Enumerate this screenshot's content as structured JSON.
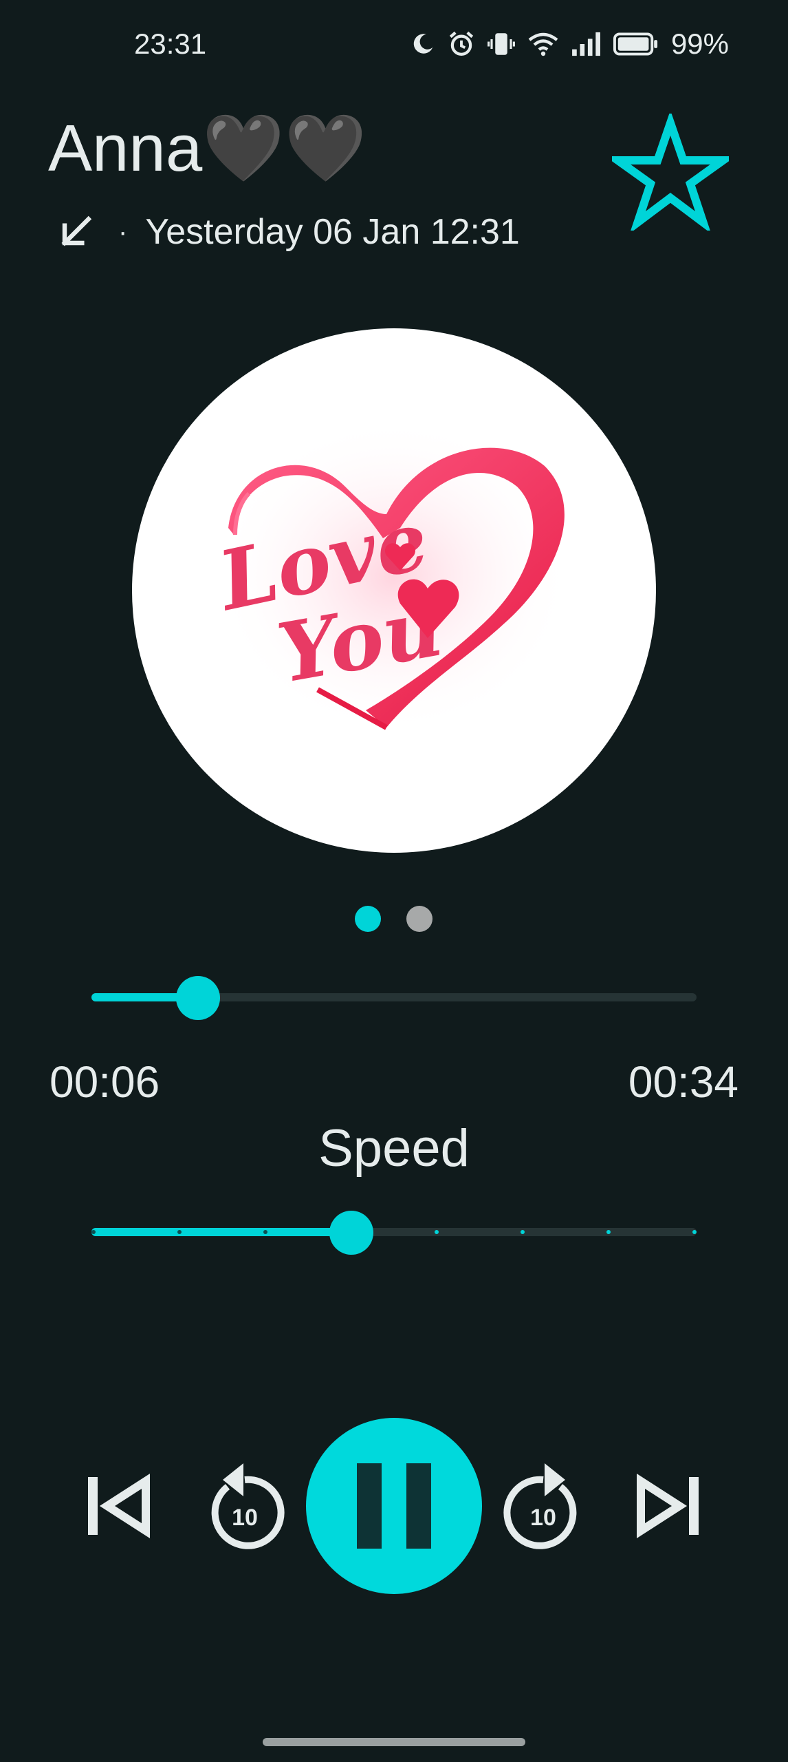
{
  "status_bar": {
    "time": "23:31",
    "battery": "99%",
    "icons": [
      "moon-icon",
      "alarm-icon",
      "vibrate-icon",
      "wifi-icon",
      "signal-icon",
      "battery-icon"
    ]
  },
  "header": {
    "contact_name": "Anna🖤🖤",
    "call_direction_icon": "incoming-call-arrow-icon",
    "separator": "·",
    "call_time": "Yesterday 06 Jan 12:31",
    "favorite_icon": "star-outline-icon"
  },
  "artwork": {
    "line1": "Love",
    "line2": "You"
  },
  "pager": {
    "pages": 2,
    "active": 1
  },
  "player": {
    "elapsed": "00:06",
    "total": "00:34",
    "progress": 0.176,
    "speed_label": "Speed",
    "speed_steps": 8,
    "speed_index": 3
  },
  "controls": [
    {
      "name": "previous-button",
      "icon": "skip-previous-icon"
    },
    {
      "name": "rewind-10-button",
      "icon": "replay-10-icon",
      "label": "10"
    },
    {
      "name": "play-pause-button",
      "icon": "pause-icon"
    },
    {
      "name": "forward-10-button",
      "icon": "forward-10-icon",
      "label": "10"
    },
    {
      "name": "next-button",
      "icon": "skip-next-icon"
    }
  ],
  "colors": {
    "background": "#101b1c",
    "accent": "#00d4d8",
    "text": "#e6ecec"
  }
}
